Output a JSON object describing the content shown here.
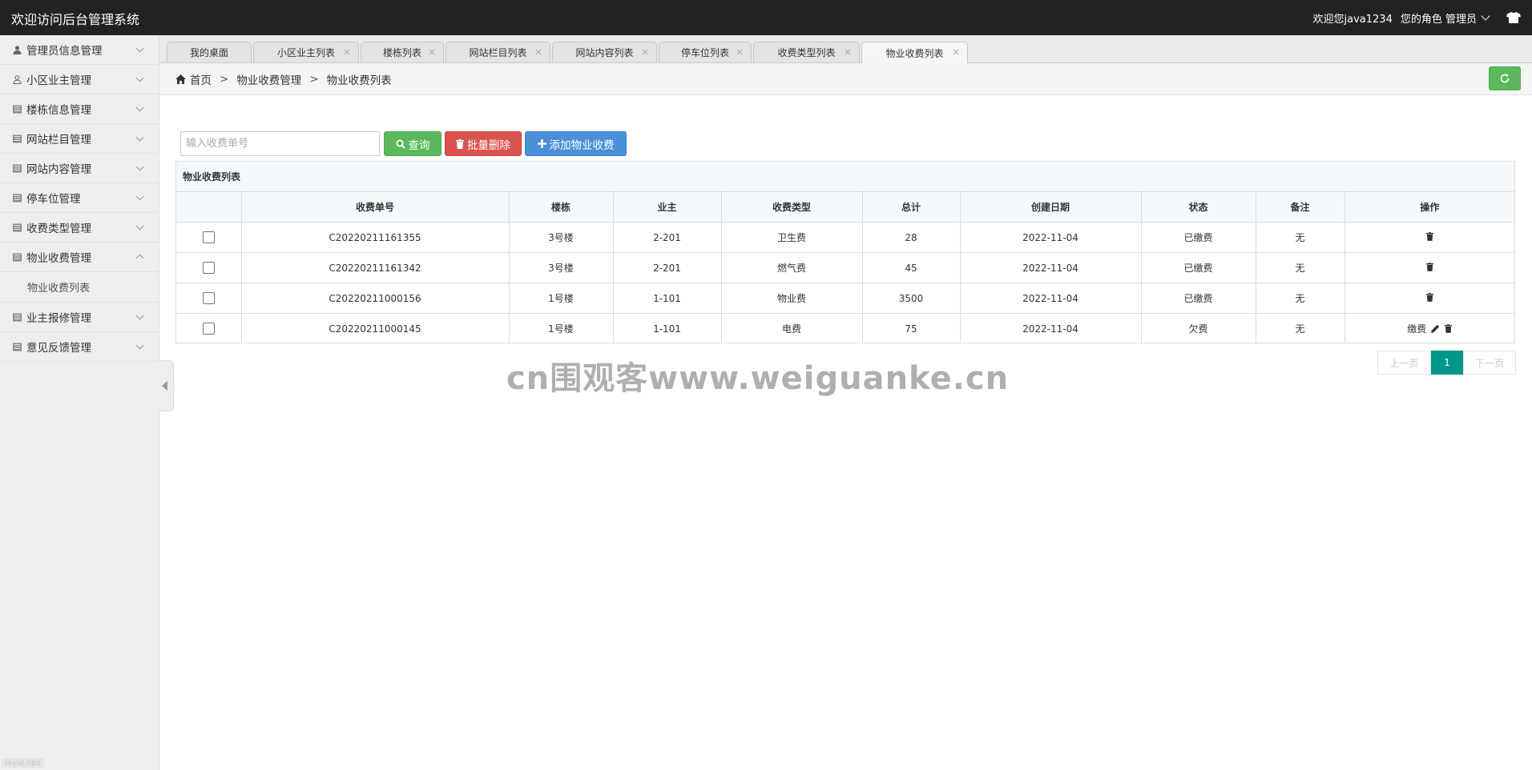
{
  "header": {
    "title": "欢迎访问后台管理系统",
    "welcome": "欢迎您java1234",
    "role": "您的角色 管理员"
  },
  "sidebar": {
    "items": [
      {
        "label": "管理员信息管理",
        "icon": "user-icon"
      },
      {
        "label": "小区业主管理",
        "icon": "user-outline-icon"
      },
      {
        "label": "楼栋信息管理",
        "icon": "list-icon"
      },
      {
        "label": "网站栏目管理",
        "icon": "list-icon"
      },
      {
        "label": "网站内容管理",
        "icon": "list-icon"
      },
      {
        "label": "停车位管理",
        "icon": "list-icon"
      },
      {
        "label": "收费类型管理",
        "icon": "list-icon"
      },
      {
        "label": "物业收费管理",
        "icon": "list-icon",
        "expanded": true
      },
      {
        "label": "业主报修管理",
        "icon": "list-icon"
      },
      {
        "label": "意见反馈管理",
        "icon": "list-icon"
      }
    ],
    "subitem": "物业收费列表",
    "version_tag": "layui.ops"
  },
  "tabs": [
    {
      "label": "我的桌面"
    },
    {
      "label": "小区业主列表"
    },
    {
      "label": "楼栋列表"
    },
    {
      "label": "网站栏目列表"
    },
    {
      "label": "网站内容列表"
    },
    {
      "label": "停车位列表"
    },
    {
      "label": "收费类型列表"
    },
    {
      "label": "物业收费列表",
      "active": true
    }
  ],
  "breadcrumb": {
    "home": "首页",
    "sep": ">",
    "level1": "物业收费管理",
    "level2": "物业收费列表"
  },
  "toolbar": {
    "search_placeholder": "输入收费单号",
    "search_label": "查询",
    "batch_delete_label": "批量删除",
    "add_label": "添加物业收费"
  },
  "table": {
    "title": "物业收费列表",
    "columns": [
      "收费单号",
      "楼栋",
      "业主",
      "收费类型",
      "总计",
      "创建日期",
      "状态",
      "备注",
      "操作"
    ],
    "rows": [
      {
        "no": "C20220211161355",
        "building": "3号楼",
        "owner": "2-201",
        "type": "卫生费",
        "total": "28",
        "date": "2022-11-04",
        "status": "已缴费",
        "note": "无",
        "pay": ""
      },
      {
        "no": "C20220211161342",
        "building": "3号楼",
        "owner": "2-201",
        "type": "燃气费",
        "total": "45",
        "date": "2022-11-04",
        "status": "已缴费",
        "note": "无",
        "pay": ""
      },
      {
        "no": "C20220211000156",
        "building": "1号楼",
        "owner": "1-101",
        "type": "物业费",
        "total": "3500",
        "date": "2022-11-04",
        "status": "已缴费",
        "note": "无",
        "pay": ""
      },
      {
        "no": "C20220211000145",
        "building": "1号楼",
        "owner": "1-101",
        "type": "电费",
        "total": "75",
        "date": "2022-11-04",
        "status": "欠费",
        "note": "无",
        "pay": "缴费"
      }
    ]
  },
  "pagination": {
    "prev": "上一页",
    "current": "1",
    "next": "下一页"
  },
  "watermark": "cn围观客www.weiguanke.cn",
  "colors": {
    "header_bg": "#222222",
    "success": "#5cb85c",
    "danger": "#d9534f",
    "primary": "#4a90d9",
    "page_active": "#009688"
  }
}
